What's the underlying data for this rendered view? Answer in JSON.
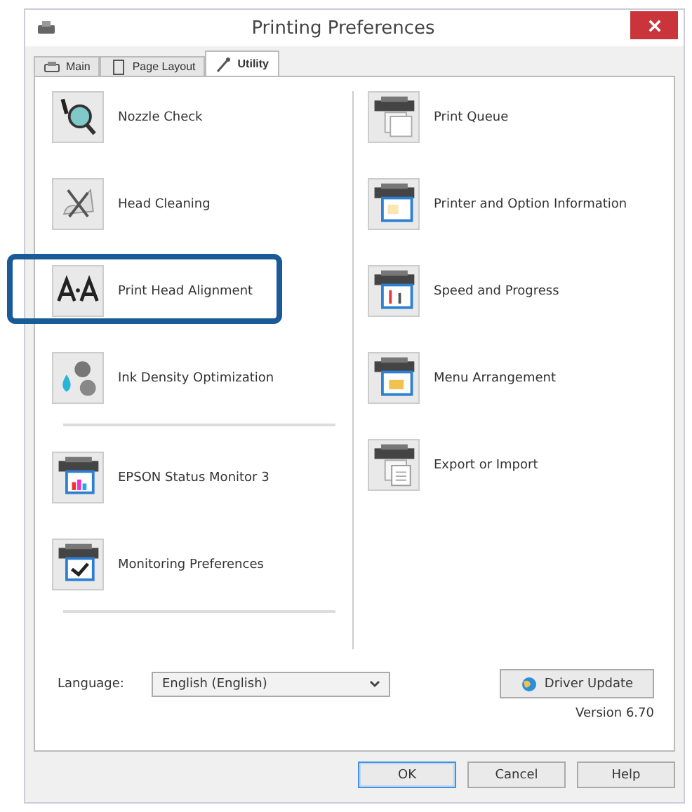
{
  "window": {
    "title": "Printing Preferences"
  },
  "tabs": [
    {
      "label": "Main",
      "kind": "printer",
      "selected": false
    },
    {
      "label": "Page Layout",
      "kind": "page",
      "selected": false
    },
    {
      "label": "Utility",
      "kind": "wrench",
      "selected": true
    }
  ],
  "left_groups": [
    [
      {
        "label": "Nozzle Check",
        "kind": "nozzle",
        "highlighted": false
      },
      {
        "label": "Head Cleaning",
        "kind": "cleaning",
        "highlighted": false
      },
      {
        "label": "Print Head Alignment",
        "kind": "alignment",
        "highlighted": true
      },
      {
        "label": "Ink Density Optimization",
        "kind": "ink",
        "highlighted": false
      }
    ],
    [
      {
        "label": "EPSON Status Monitor 3",
        "kind": "monitor",
        "highlighted": false
      },
      {
        "label": "Monitoring Preferences",
        "kind": "check",
        "highlighted": false
      }
    ]
  ],
  "right_items": [
    {
      "label": "Print Queue",
      "kind": "queue",
      "highlighted": false
    },
    {
      "label": "Printer and Option Information",
      "kind": "info",
      "highlighted": false
    },
    {
      "label": "Speed and Progress",
      "kind": "speed",
      "highlighted": false
    },
    {
      "label": "Menu Arrangement",
      "kind": "menu",
      "highlighted": false
    },
    {
      "label": "Export or Import",
      "kind": "export",
      "highlighted": false
    }
  ],
  "language": {
    "label": "Language:",
    "value": "English (English)"
  },
  "driver_update": "Driver Update",
  "version": "Version 6.70",
  "buttons": [
    {
      "label": "OK",
      "default": true
    },
    {
      "label": "Cancel",
      "default": false
    },
    {
      "label": "Help",
      "default": false
    }
  ]
}
